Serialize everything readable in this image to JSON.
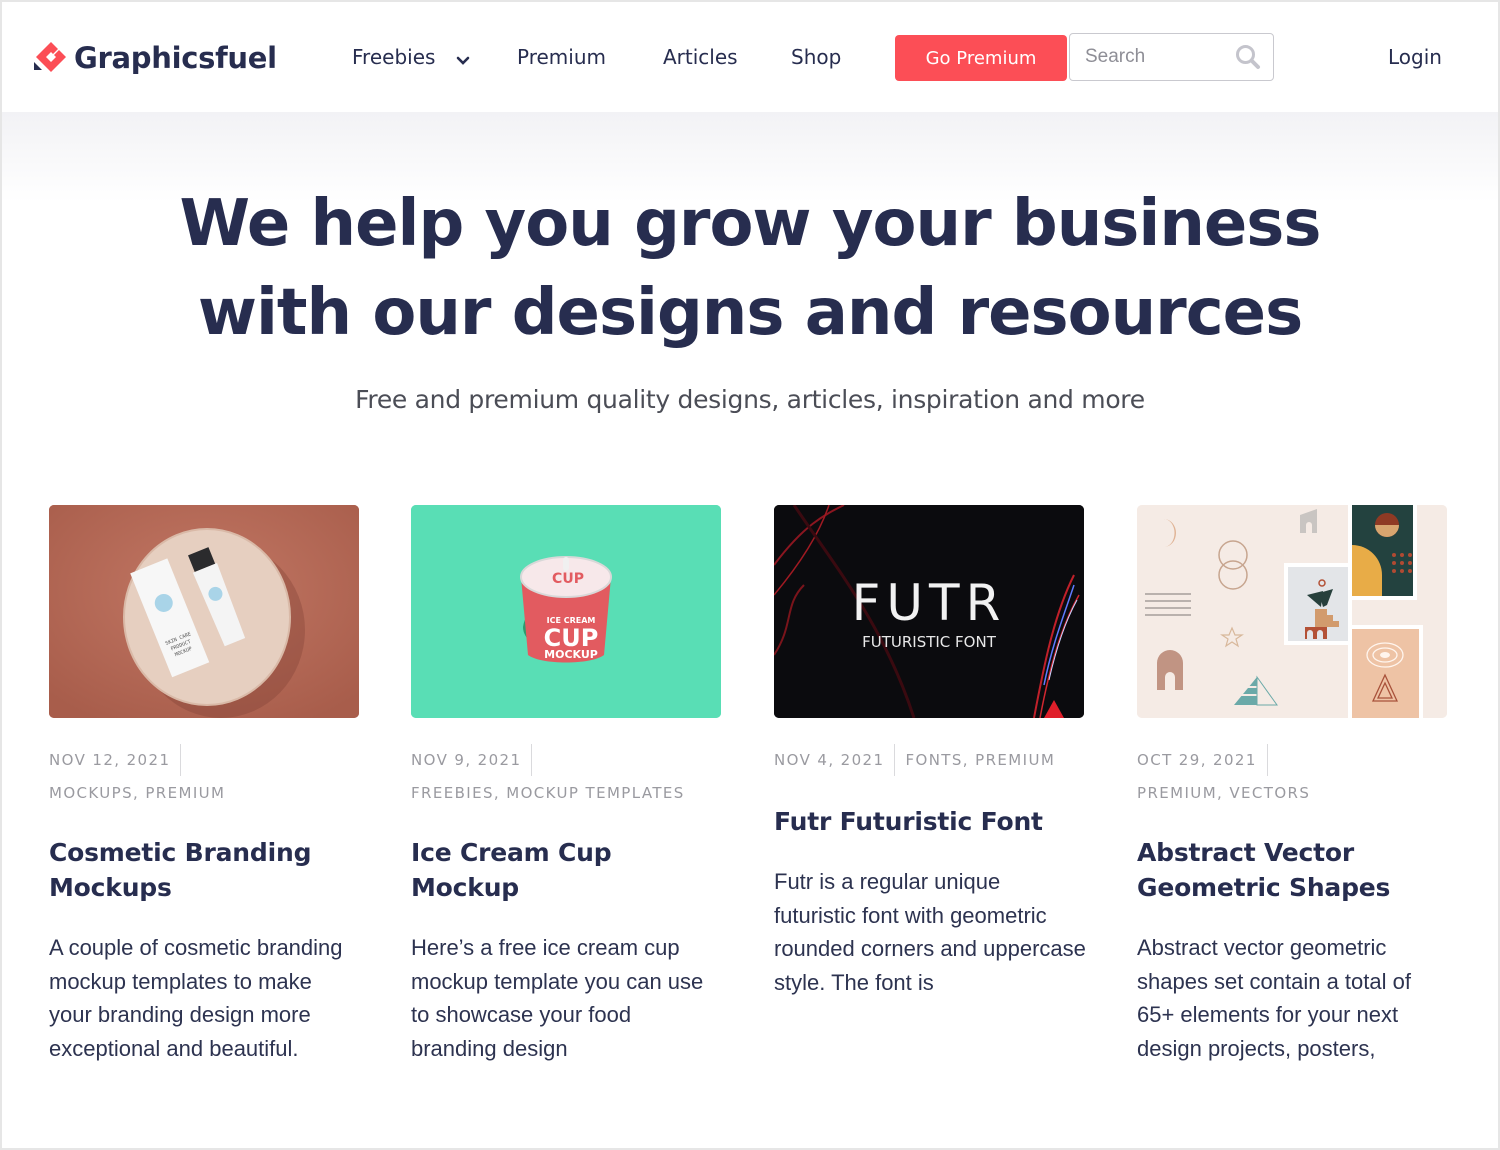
{
  "header": {
    "logo_text": "Graphicsfuel",
    "nav": [
      {
        "label": "Freebies",
        "has_dropdown": true
      },
      {
        "label": "Premium",
        "has_dropdown": false
      },
      {
        "label": "Articles",
        "has_dropdown": false
      },
      {
        "label": "Shop",
        "has_dropdown": false
      }
    ],
    "cta_label": "Go Premium",
    "search": {
      "placeholder": "Search",
      "value": "",
      "icon": "search-icon"
    },
    "login_label": "Login"
  },
  "hero": {
    "title_line1": "We help you grow your business",
    "title_line2": "with our designs and resources",
    "subtitle": "Free and premium quality designs, articles, inspiration and more"
  },
  "colors": {
    "brand_red": "#fc4e56",
    "navy": "#272d4f",
    "meta_gray": "#9a9aa0"
  },
  "cards": [
    {
      "thumb": "cosmetic-branding-mockup-image",
      "date": "NOV 12, 2021",
      "categories": "MOCKUPS, PREMIUM",
      "title": "Cosmetic Branding Mockups",
      "description": "A couple of cosmetic branding mockup templates to make your branding design more exceptional and beautiful.",
      "thumb_text": [
        "SKIN CARE",
        "PRODUCT",
        "MOCKUP"
      ]
    },
    {
      "thumb": "ice-cream-cup-mockup-image",
      "date": "NOV 9, 2021",
      "categories": "FREEBIES, MOCKUP TEMPLATES",
      "title": "Ice Cream Cup Mockup",
      "description": "Here’s a free ice cream cup mockup template you can use to showcase your food branding design",
      "thumb_text": [
        "ICE CREAM",
        "CUP",
        "MOCKUP"
      ]
    },
    {
      "thumb": "futr-font-image",
      "date": "NOV 4, 2021",
      "categories": "FONTS, PREMIUM",
      "title": "Futr Futuristic Font",
      "description": "Futr is a regular unique futuristic font with geometric rounded corners and uppercase style. The font is",
      "thumb_text": [
        "FUTR",
        "FUTURISTIC FONT"
      ]
    },
    {
      "thumb": "abstract-geometric-shapes-image",
      "date": "OCT 29, 2021",
      "categories": "PREMIUM, VECTORS",
      "title": "Abstract Vector Geometric Shapes",
      "description": "Abstract vector geometric shapes set contain a total of 65+ elements for your next design projects, posters,"
    }
  ]
}
